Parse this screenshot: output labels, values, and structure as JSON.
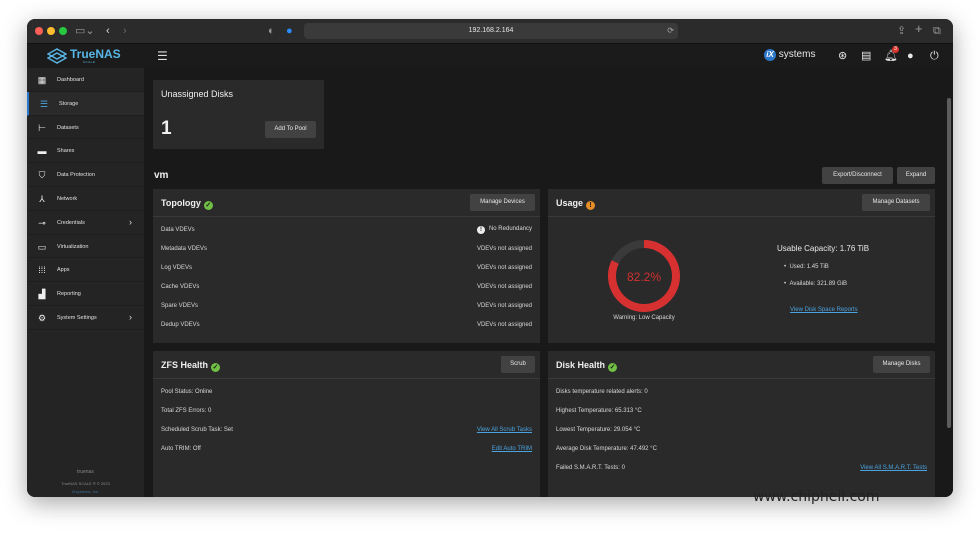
{
  "browser": {
    "url": "192.168.2.164"
  },
  "brand": {
    "logo_text": "TrueNAS",
    "logo_sub": "SCALE",
    "ix_logo": "systems",
    "notification_count": "3"
  },
  "sidebar": {
    "items": [
      {
        "label": "Dashboard",
        "icon": "dashboard-icon"
      },
      {
        "label": "Storage",
        "icon": "storage-icon"
      },
      {
        "label": "Datasets",
        "icon": "datasets-icon"
      },
      {
        "label": "Shares",
        "icon": "shares-icon"
      },
      {
        "label": "Data Protection",
        "icon": "shield-icon"
      },
      {
        "label": "Network",
        "icon": "network-icon"
      },
      {
        "label": "Credentials",
        "icon": "key-icon"
      },
      {
        "label": "Virtualization",
        "icon": "monitor-icon"
      },
      {
        "label": "Apps",
        "icon": "apps-grid-icon"
      },
      {
        "label": "Reporting",
        "icon": "chart-icon"
      },
      {
        "label": "System Settings",
        "icon": "gear-icon"
      }
    ],
    "footer_host": "truenas",
    "footer_copyright": "TrueNAS SCALE ® © 2023",
    "footer_company": "iXsystems, Inc."
  },
  "unassigned": {
    "title": "Unassigned Disks",
    "count": "1",
    "button": "Add To Pool"
  },
  "pool": {
    "name": "vm",
    "export_button": "Export/Disconnect",
    "expand_button": "Expand"
  },
  "topology": {
    "title": "Topology",
    "button": "Manage Devices",
    "rows": [
      {
        "label": "Data VDEVs",
        "value": "No Redundancy"
      },
      {
        "label": "Metadata VDEVs",
        "value": "VDEVs not assigned"
      },
      {
        "label": "Log VDEVs",
        "value": "VDEVs not assigned"
      },
      {
        "label": "Cache VDEVs",
        "value": "VDEVs not assigned"
      },
      {
        "label": "Spare VDEVs",
        "value": "VDEVs not assigned"
      },
      {
        "label": "Dedup VDEVs",
        "value": "VDEVs not assigned"
      }
    ]
  },
  "usage": {
    "title": "Usage",
    "button": "Manage Datasets",
    "percent_text": "82.2%",
    "percent_value": 82.2,
    "warning": "Warning: Low Capacity",
    "capacity": "Usable Capacity: 1.76 TiB",
    "used": "Used: 1.45 TiB",
    "available": "Available: 321.89 GiB",
    "link": "View Disk Space Reports",
    "gauge_color": "#d63030"
  },
  "zfs": {
    "title": "ZFS Health",
    "button": "Scrub",
    "rows": [
      "Pool Status: Online",
      "Total ZFS Errors: 0",
      "Scheduled Scrub Task: Set",
      "Auto TRIM: Off"
    ],
    "link_scrub": "View All Scrub Tasks",
    "link_trim": "Edit Auto TRIM"
  },
  "disk_health": {
    "title": "Disk Health",
    "button": "Manage Disks",
    "rows": [
      "Disks temperature related alerts: 0",
      "Highest Temperature: 65.313 °C",
      "Lowest Temperature: 29.054 °C",
      "Average Disk Temperature: 47.492 °C",
      "Failed S.M.A.R.T. Tests: 0"
    ],
    "link_smart": "View All S.M.A.R.T. Tests"
  },
  "watermark": "www.chiphell.com"
}
